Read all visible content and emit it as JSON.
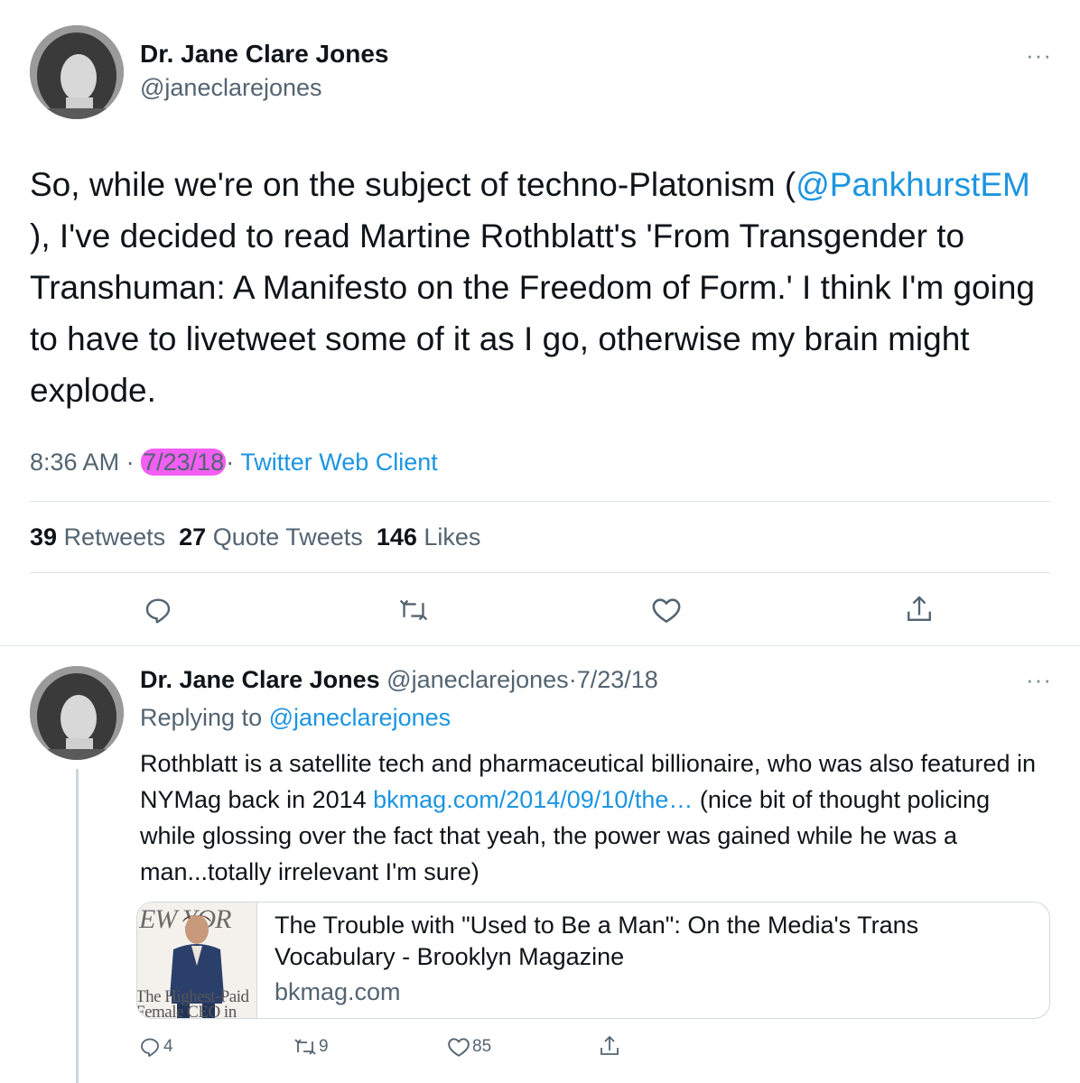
{
  "main_tweet": {
    "display_name": "Dr. Jane Clare Jones",
    "handle": "@janeclarejones",
    "more": "···",
    "text_start": "So, while we're on the subject of techno-Platonism (",
    "mention": "@PankhurstEM",
    "text_end": " ), I've decided to read Martine Rothblatt's 'From Transgender to Transhuman: A Manifesto on the Freedom of Form.' I think I'm going to have to livetweet some of it as I go, otherwise my brain might explode.",
    "time": "8:36 AM",
    "sep": "·",
    "date": "7/23/18",
    "client": "Twitter Web Client",
    "retweets_count": "39",
    "retweets_label": "Retweets",
    "quotes_count": "27",
    "quotes_label": "Quote Tweets",
    "likes_count": "146",
    "likes_label": "Likes",
    "highlight_color": "#f25ff2"
  },
  "reply_tweet": {
    "display_name": "Dr. Jane Clare Jones",
    "handle": "@janeclarejones",
    "sep": "·",
    "date": "7/23/18",
    "more": "···",
    "replying_prefix": "Replying to ",
    "replying_handle": "@janeclarejones",
    "text_start": "Rothblatt is a satellite tech and pharmaceutical billionaire, who was also featured in NYMag back in 2014 ",
    "link": "bkmag.com/2014/09/10/the…",
    "text_end": " (nice bit of thought policing while glossing over the fact that yeah, the power was gained while he was a man...totally irrelevant I'm sure)",
    "card": {
      "thumb_text_top": "EW YOR",
      "thumb_text_bottom": "The Highest-Paid Female CEO in",
      "title": "The Trouble with \"Used to Be a Man\": On the Media's Trans Vocabulary - Brooklyn Magazine",
      "domain": "bkmag.com"
    },
    "reply_count": "4",
    "retweet_count": "9",
    "like_count": "85"
  },
  "icons": {
    "reply": "reply-icon",
    "retweet": "retweet-icon",
    "like": "heart-icon",
    "share": "share-icon",
    "more": "more-icon"
  },
  "colors": {
    "link": "#1b95e0",
    "secondary": "#536471",
    "text": "#0f1419"
  }
}
